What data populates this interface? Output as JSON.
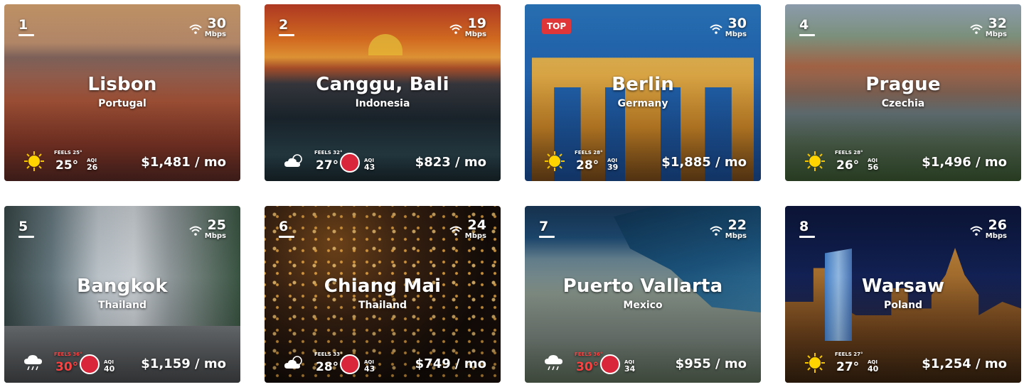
{
  "cards": [
    {
      "rank": "1",
      "badge": "",
      "city": "Lisbon",
      "country": "Portugal",
      "speed": "30",
      "speed_unit": "Mbps",
      "feels": "FEELS 25°",
      "temp": "25°",
      "aqi_label": "AQI",
      "aqi": "26",
      "price": "$1,481 / mo",
      "weather": "sun-icon",
      "hot": false,
      "face": false
    },
    {
      "rank": "2",
      "badge": "",
      "city": "Canggu, Bali",
      "country": "Indonesia",
      "speed": "19",
      "speed_unit": "Mbps",
      "feels": "FEELS 32°",
      "temp": "27°",
      "aqi_label": "AQI",
      "aqi": "43",
      "price": "$823 / mo",
      "weather": "cloud-sun-icon",
      "hot": false,
      "face": true
    },
    {
      "rank": "",
      "badge": "TOP",
      "city": "Berlin",
      "country": "Germany",
      "speed": "30",
      "speed_unit": "Mbps",
      "feels": "FEELS 28°",
      "temp": "28°",
      "aqi_label": "AQI",
      "aqi": "39",
      "price": "$1,885 / mo",
      "weather": "sun-icon",
      "hot": false,
      "face": false
    },
    {
      "rank": "4",
      "badge": "",
      "city": "Prague",
      "country": "Czechia",
      "speed": "32",
      "speed_unit": "Mbps",
      "feels": "FEELS 28°",
      "temp": "26°",
      "aqi_label": "AQI",
      "aqi": "56",
      "price": "$1,496 / mo",
      "weather": "sun-icon",
      "hot": false,
      "face": false
    },
    {
      "rank": "5",
      "badge": "",
      "city": "Bangkok",
      "country": "Thailand",
      "speed": "25",
      "speed_unit": "Mbps",
      "feels": "FEELS 36°",
      "temp": "30°",
      "aqi_label": "AQI",
      "aqi": "40",
      "price": "$1,159 / mo",
      "weather": "rain-cloud-icon",
      "hot": true,
      "face": true
    },
    {
      "rank": "6",
      "badge": "",
      "city": "Chiang Mai",
      "country": "Thailand",
      "speed": "24",
      "speed_unit": "Mbps",
      "feels": "FEELS 33°",
      "temp": "28°",
      "aqi_label": "AQI",
      "aqi": "43",
      "price": "$749 / mo",
      "weather": "cloud-sun-icon",
      "hot": false,
      "face": true
    },
    {
      "rank": "7",
      "badge": "",
      "city": "Puerto Vallarta",
      "country": "Mexico",
      "speed": "22",
      "speed_unit": "Mbps",
      "feels": "FEELS 36°",
      "temp": "30°",
      "aqi_label": "AQI",
      "aqi": "34",
      "price": "$955 / mo",
      "weather": "rain-cloud-icon",
      "hot": true,
      "face": true
    },
    {
      "rank": "8",
      "badge": "",
      "city": "Warsaw",
      "country": "Poland",
      "speed": "26",
      "speed_unit": "Mbps",
      "feels": "FEELS 27°",
      "temp": "27°",
      "aqi_label": "AQI",
      "aqi": "40",
      "price": "$1,254 / mo",
      "weather": "sun-icon",
      "hot": false,
      "face": false
    }
  ]
}
